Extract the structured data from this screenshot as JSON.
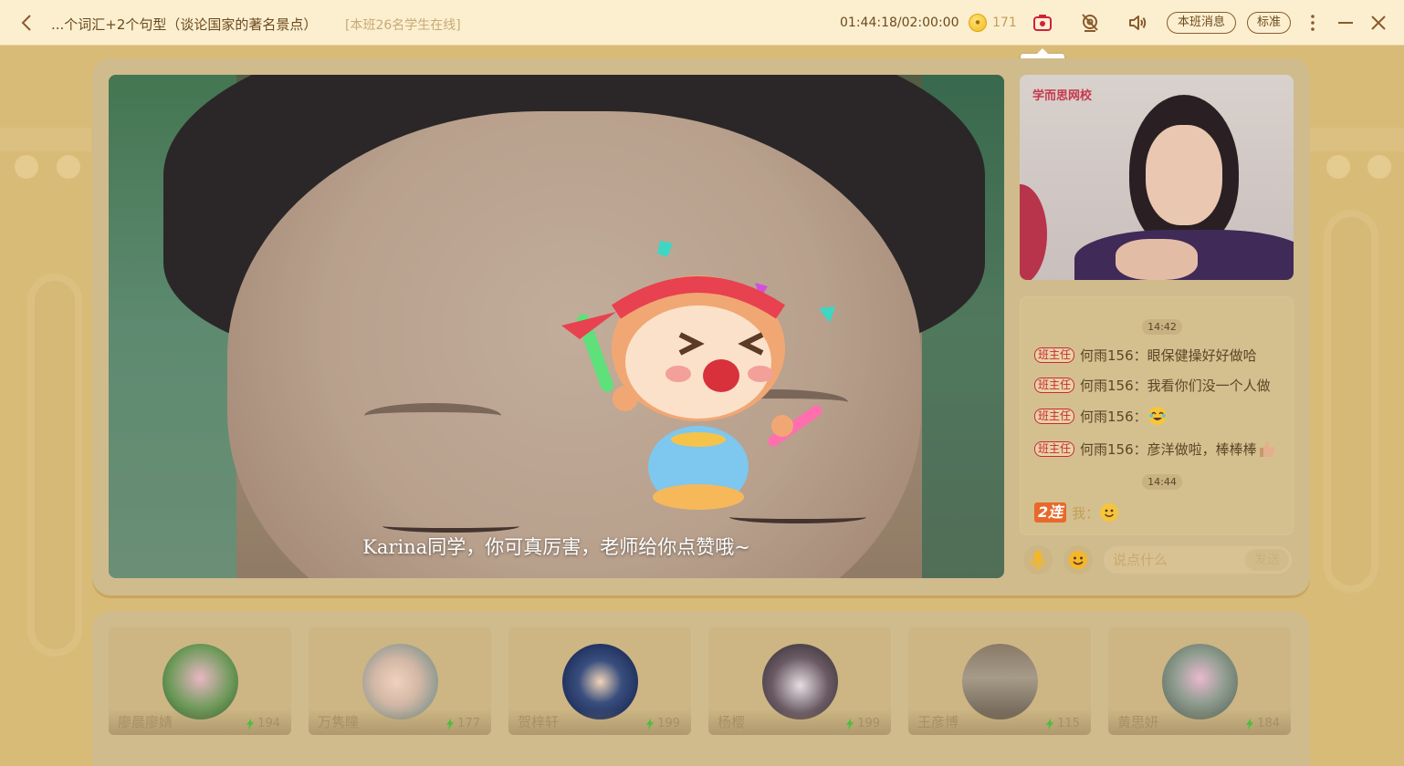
{
  "header": {
    "title": "...个词汇+2个句型（谈论国家的著名景点）",
    "online_status": "[本班26名学生在线]",
    "timer": "01:44:18/02:00:00",
    "coins": "171",
    "class_message_label": "本班消息",
    "quality_label": "标准",
    "tooltip_screenshot": "截屏"
  },
  "icons": {
    "back": "chevron-left-icon",
    "screenshot": "camera-icon",
    "camera_off": "camera-off-icon",
    "volume": "volume-icon",
    "more": "more-vertical-icon",
    "minimize": "minimize-icon",
    "close": "close-icon"
  },
  "main_video": {
    "caption": "Karina同学，你可真厉害，老师给你点赞哦~"
  },
  "teacher_video": {
    "logo_text": "学而思网校"
  },
  "chat": {
    "time_1": "14:42",
    "messages": [
      {
        "role": "班主任",
        "sender": "何雨156",
        "text": "眼保健操好好做哈"
      },
      {
        "role": "班主任",
        "sender": "何雨156",
        "text": "我看你们没一个人做"
      },
      {
        "role": "班主任",
        "sender": "何雨156",
        "text": ""
      },
      {
        "role": "班主任",
        "sender": "何雨156",
        "text": "彦洋做啦，棒棒棒"
      }
    ],
    "time_2": "14:44",
    "my_combo": "2连",
    "my_name": "我",
    "input_placeholder": "说点什么",
    "send_label": "发送"
  },
  "students": [
    {
      "name": "廖晨廖婧",
      "score": "194"
    },
    {
      "name": "万隽瞳",
      "score": "177"
    },
    {
      "name": "贺梓轩",
      "score": "199"
    },
    {
      "name": "杨樱",
      "score": "199"
    },
    {
      "name": "王彦博",
      "score": "115"
    },
    {
      "name": "黄思妍",
      "score": "184"
    }
  ],
  "colors": {
    "topbar_bg": "#fcefd0",
    "page_bg": "#d9bb78",
    "accent_red": "#c8283f",
    "combo_orange": "#e8692c"
  }
}
